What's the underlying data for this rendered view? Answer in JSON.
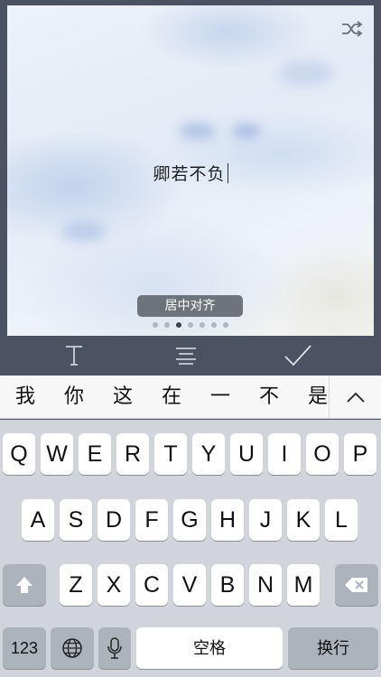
{
  "card": {
    "text": "卿若不负",
    "align_badge": "居中对齐",
    "page_count": 7,
    "active_page": 3,
    "shuffle_icon": "shuffle-icon"
  },
  "toolbar": {
    "text_tool_icon": "text-format-icon",
    "align_tool_icon": "align-center-icon",
    "done_icon": "checkmark-icon"
  },
  "candidates": [
    "我",
    "你",
    "这",
    "在",
    "一",
    "不",
    "是"
  ],
  "keyboard": {
    "row1": [
      "Q",
      "W",
      "E",
      "R",
      "T",
      "Y",
      "U",
      "I",
      "O",
      "P"
    ],
    "row2": [
      "A",
      "S",
      "D",
      "F",
      "G",
      "H",
      "J",
      "K",
      "L"
    ],
    "row3": [
      "Z",
      "X",
      "C",
      "V",
      "B",
      "N",
      "M"
    ],
    "numbers_label": "123",
    "space_label": "空格",
    "return_label": "换行",
    "shift_icon": "shift-icon",
    "delete_icon": "delete-icon",
    "globe_icon": "globe-icon",
    "mic_icon": "microphone-icon"
  },
  "colors": {
    "chrome": "#4b5262",
    "keyboard_bg": "#d1d5db",
    "key": "#ffffff",
    "key_dark": "#adb3bd"
  }
}
